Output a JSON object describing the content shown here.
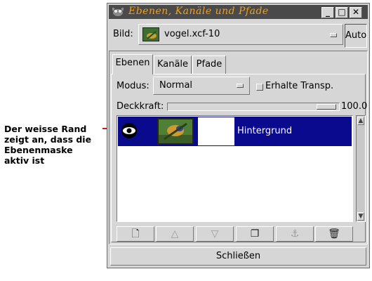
{
  "annotation": {
    "lines": [
      "Der weisse Rand",
      "zeigt an, dass die",
      "Ebenenmaske",
      "aktiv ist"
    ]
  },
  "window": {
    "title": "Ebenen, Kanäle und Pfade",
    "controls": [
      "minimize",
      "maximize",
      "close"
    ]
  },
  "image_selector": {
    "label": "Bild:",
    "value": "vogel.xcf-10",
    "auto_label": "Auto"
  },
  "tabs": [
    {
      "label": "Ebenen",
      "active": true
    },
    {
      "label": "Kanäle",
      "active": false
    },
    {
      "label": "Pfade",
      "active": false
    }
  ],
  "modus": {
    "label": "Modus:",
    "value": "Normal",
    "keep_transparency_label": "Erhalte Transp.",
    "keep_transparency_checked": false
  },
  "opacity": {
    "label": "Deckkraft:",
    "value": "100.0",
    "fraction": 1.0
  },
  "layers": [
    {
      "name": "Hintergrund",
      "visible": true,
      "selected": true,
      "mask_active": true
    }
  ],
  "toolbar_buttons": [
    {
      "icon": "new-layer-icon",
      "glyph": "🗋",
      "enabled": true
    },
    {
      "icon": "raise-layer-icon",
      "glyph": "△",
      "enabled": false
    },
    {
      "icon": "lower-layer-icon",
      "glyph": "▽",
      "enabled": false
    },
    {
      "icon": "duplicate-layer-icon",
      "glyph": "❐",
      "enabled": true
    },
    {
      "icon": "anchor-layer-icon",
      "glyph": "⚓",
      "enabled": false
    },
    {
      "icon": "delete-layer-icon",
      "glyph": "🗑",
      "enabled": true
    }
  ],
  "close_button": "Schließen",
  "colors": {
    "selection": "#0a0a8e",
    "title_text": "#f0a020",
    "arrow": "#e01010"
  }
}
